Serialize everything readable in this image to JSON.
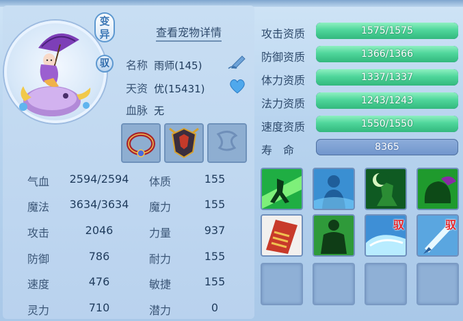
{
  "header": {
    "detail_link": "查看宠物详情"
  },
  "pet": {
    "mutation_label": "变异",
    "bound_label": "驭",
    "name_label": "名称",
    "name_value": "雨师(145)",
    "talent_label": "天资",
    "talent_value": "优(15431)",
    "bloodline_label": "血脉",
    "bloodline_value": "无"
  },
  "equipment": [
    {
      "name": "equip-slot-collar",
      "icon": "collar-icon",
      "state": "filled"
    },
    {
      "name": "equip-slot-armor",
      "icon": "armor-icon",
      "state": "filled"
    },
    {
      "name": "equip-slot-empty",
      "icon": "empty-slot-icon",
      "state": "empty"
    }
  ],
  "stats": [
    {
      "label": "气血",
      "value": "2594/2594",
      "label2": "体质",
      "value2": "155"
    },
    {
      "label": "魔法",
      "value": "3634/3634",
      "label2": "魔力",
      "value2": "155"
    },
    {
      "label": "攻击",
      "value": "2046",
      "label2": "力量",
      "value2": "937"
    },
    {
      "label": "防御",
      "value": "786",
      "label2": "耐力",
      "value2": "155"
    },
    {
      "label": "速度",
      "value": "476",
      "label2": "敏捷",
      "value2": "155"
    },
    {
      "label": "灵力",
      "value": "710",
      "label2": "潜力",
      "value2": "0"
    }
  ],
  "aptitudes": [
    {
      "label": "攻击资质",
      "text": "1575/1575",
      "current": 1575,
      "max": 1575
    },
    {
      "label": "防御资质",
      "text": "1366/1366",
      "current": 1366,
      "max": 1366
    },
    {
      "label": "体力资质",
      "text": "1337/1337",
      "current": 1337,
      "max": 1337
    },
    {
      "label": "法力资质",
      "text": "1243/1243",
      "current": 1243,
      "max": 1243
    },
    {
      "label": "速度资质",
      "text": "1550/1550",
      "current": 1550,
      "max": 1550
    }
  ],
  "life": {
    "label": "寿　命",
    "value": "8365"
  },
  "skills": [
    {
      "icon": "shadow-strike-icon",
      "bound": "",
      "color": "#1fae43"
    },
    {
      "icon": "water-figure-icon",
      "bound": "",
      "color": "#3a8fd2"
    },
    {
      "icon": "moon-warrior-icon",
      "bound": "",
      "color": "#2b8c34"
    },
    {
      "icon": "green-beast-icon",
      "bound": "",
      "color": "#1f9a2d"
    },
    {
      "icon": "red-scroll-icon",
      "bound": "",
      "color": "#c83a2a"
    },
    {
      "icon": "green-giant-icon",
      "bound": "",
      "color": "#2f9a3a"
    },
    {
      "icon": "water-wave-icon",
      "bound": "驭",
      "color": "#3e8fd6"
    },
    {
      "icon": "ice-blade-icon",
      "bound": "驭",
      "color": "#5aa6e0"
    },
    {
      "icon": "empty-slot-icon",
      "bound": "",
      "color": ""
    },
    {
      "icon": "empty-slot-icon",
      "bound": "",
      "color": ""
    },
    {
      "icon": "empty-slot-icon",
      "bound": "",
      "color": ""
    },
    {
      "icon": "empty-slot-icon",
      "bound": "",
      "color": ""
    }
  ],
  "colors": {
    "bar_green": "#4fd69b",
    "bar_track": "#5a7fb0",
    "life_bar": "#7f9fd6",
    "bound_red": "#e6262b"
  }
}
